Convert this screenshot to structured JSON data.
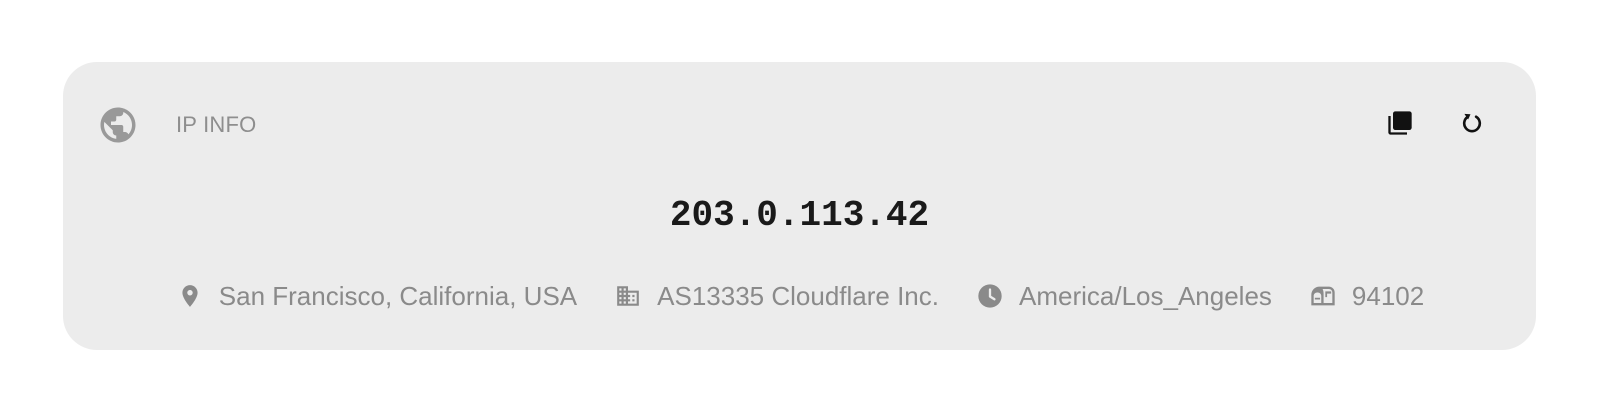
{
  "header": {
    "title": "IP INFO",
    "icon": "globe-icon"
  },
  "actions": {
    "copy_icon": "copy-icon",
    "refresh_icon": "refresh-icon"
  },
  "ip_address": "203.0.113.42",
  "details": {
    "location": "San Francisco, California, USA",
    "asn": "AS13335 Cloudflare Inc.",
    "timezone": "America/Los_Angeles",
    "postal": "94102"
  },
  "colors": {
    "card_background": "#ececec",
    "muted_text": "#8a8a8a",
    "ip_text": "#1a1a1a"
  }
}
